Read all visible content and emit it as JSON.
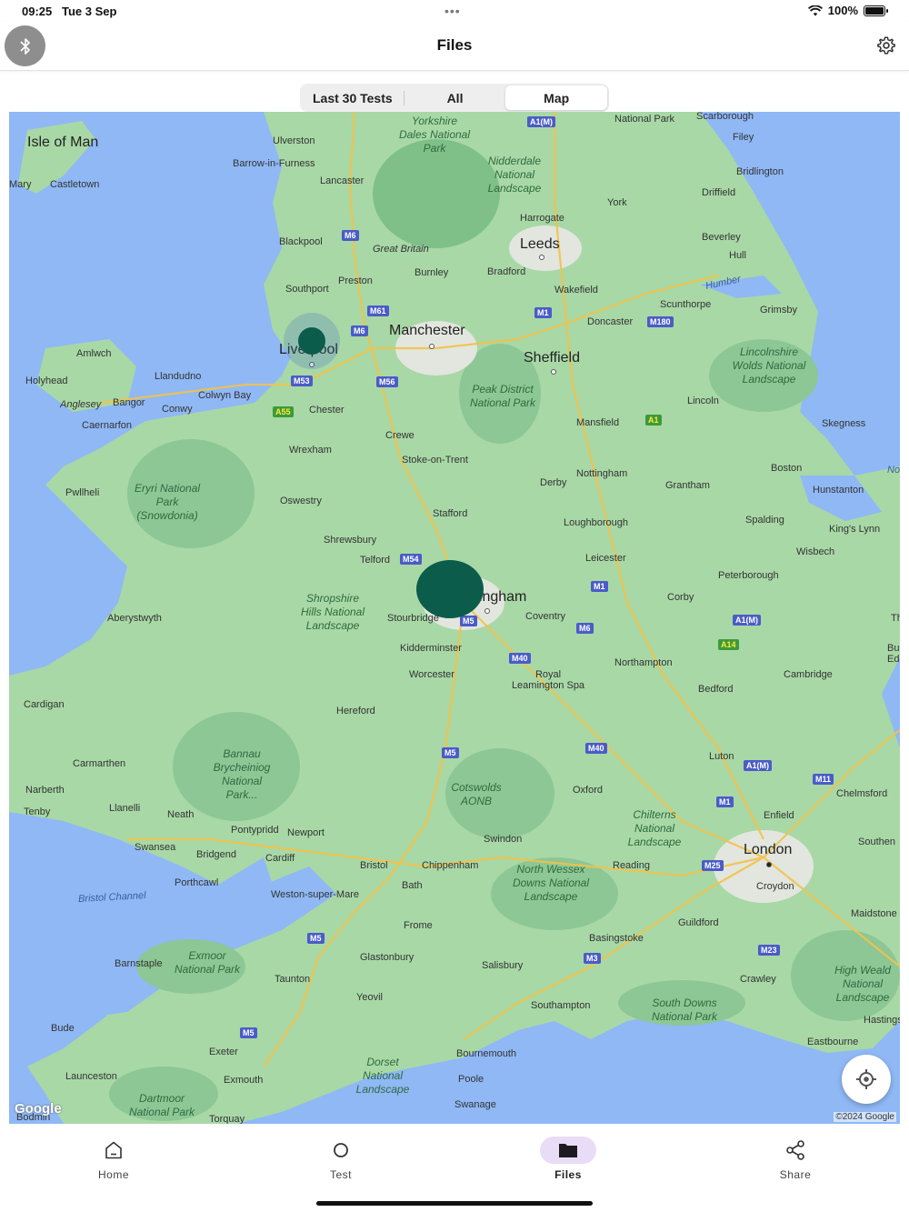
{
  "status_bar": {
    "time": "09:25",
    "date": "Tue 3 Sep",
    "battery": "100%"
  },
  "nav": {
    "title": "Files",
    "bluetooth_icon": "bluetooth-icon",
    "settings_icon": "gear-icon"
  },
  "segments": [
    {
      "label": "Last 30 Tests",
      "active": false
    },
    {
      "label": "All",
      "active": false
    },
    {
      "label": "Map",
      "active": true
    }
  ],
  "map": {
    "labels": {
      "isle_of_man": "Isle of Man",
      "ulverston": "Ulverston",
      "barrow": "Barrow-in-Furness",
      "castletown": "Castletown",
      "mary": "Mary",
      "yorkshire_dales": "Yorkshire Dales National Park",
      "nidderdale": "Nidderdale National Landscape",
      "national_park_ne": "National Park",
      "scarborough": "Scarborough",
      "filey": "Filey",
      "bridlington": "Bridlington",
      "driffield": "Driffield",
      "lancaster": "Lancaster",
      "york": "York",
      "harrogate": "Harrogate",
      "leeds": "Leeds",
      "beverley": "Beverley",
      "hull": "Hull",
      "blackpool": "Blackpool",
      "great_britain": "Great Britain",
      "burnley": "Burnley",
      "bradford": "Bradford",
      "preston": "Preston",
      "southport": "Southport",
      "wakefield": "Wakefield",
      "humber": "Humber",
      "scunthorpe": "Scunthorpe",
      "grimsby": "Grimsby",
      "manchester": "Manchester",
      "doncaster": "Doncaster",
      "amlwch": "Amlwch",
      "liverpool": "Liverpool",
      "sheffield": "Sheffield",
      "lincolnshire_wolds": "Lincolnshire Wolds National Landscape",
      "holyhead": "Holyhead",
      "llandudno": "Llandudno",
      "anglesey": "Anglesey",
      "bangor": "Bangor",
      "colwyn_bay": "Colwyn Bay",
      "conwy": "Conwy",
      "peak_district": "Peak District National Park",
      "lincoln": "Lincoln",
      "caernarfon": "Caernarfon",
      "chester": "Chester",
      "mansfield": "Mansfield",
      "skegness": "Skegness",
      "crewe": "Crewe",
      "wrexham": "Wrexham",
      "stoke": "Stoke-on-Trent",
      "boston": "Boston",
      "nottingham": "Nottingham",
      "derby": "Derby",
      "grantham": "Grantham",
      "pwllheli": "Pwllheli",
      "eryri": "Eryri National Park (Snowdonia)",
      "hunstanton": "Hunstanton",
      "oswestry": "Oswestry",
      "stafford": "Stafford",
      "loughborough": "Loughborough",
      "spalding": "Spalding",
      "kings_lynn": "King's Lynn",
      "shrewsbury": "Shrewsbury",
      "wisbech": "Wisbech",
      "telford": "Telford",
      "leicester": "Leicester",
      "peterborough": "Peterborough",
      "shropshire_hills": "Shropshire Hills National Landscape",
      "birmingham": "Birmingham",
      "corby": "Corby",
      "aberystwyth": "Aberystwyth",
      "stourbridge": "Stourbridge",
      "coventry": "Coventry",
      "kidderminster": "Kidderminster",
      "northampton": "Northampton",
      "royal_leamington": "Royal Leamington Spa",
      "worcester": "Worcester",
      "cambridge": "Cambridge",
      "cardigan": "Cardigan",
      "bedford": "Bedford",
      "hereford": "Hereford",
      "bannau": "Bannau Brycheiniog National Park...",
      "carmarthen": "Carmarthen",
      "luton": "Luton",
      "narberth": "Narberth",
      "cotswolds": "Cotswolds AONB",
      "oxford": "Oxford",
      "chelmsford": "Chelmsford",
      "tenby": "Tenby",
      "llanelli": "Llanelli",
      "neath": "Neath",
      "chilterns": "Chilterns National Landscape",
      "enfield": "Enfield",
      "pontypridd": "Pontypridd",
      "newport": "Newport",
      "swansea": "Swansea",
      "swindon": "Swindon",
      "london": "London",
      "bridgend": "Bridgend",
      "cardiff": "Cardiff",
      "bristol": "Bristol",
      "chippenham": "Chippenham",
      "reading": "Reading",
      "north_wessex": "North Wessex Downs National Landscape",
      "croydon": "Croydon",
      "porthcawl": "Porthcawl",
      "bath": "Bath",
      "bristol_channel": "Bristol Channel",
      "weston": "Weston-super-Mare",
      "maidstone": "Maidstone",
      "frome": "Frome",
      "guildford": "Guildford",
      "basingstoke": "Basingstoke",
      "exmoor": "Exmoor National Park",
      "glastonbury": "Glastonbury",
      "barnstaple": "Barnstaple",
      "salisbury": "Salisbury",
      "crawley": "Crawley",
      "high_weald": "High Weald National Landscape",
      "taunton": "Taunton",
      "yeovil": "Yeovil",
      "southampton": "Southampton",
      "south_downs": "South Downs National Park",
      "bude": "Bude",
      "hastings": "Hastings",
      "exeter": "Exeter",
      "bournemouth": "Bournemouth",
      "eastbourne": "Eastbourne",
      "dorset": "Dorset National Landscape",
      "launceston": "Launceston",
      "exmouth": "Exmouth",
      "poole": "Poole",
      "dartmoor": "Dartmoor National Park",
      "swanage": "Swanage",
      "bodmin": "Bodmin",
      "torquay": "Torquay",
      "southend": "Southen",
      "no": "No",
      "th": "Th",
      "bu_edn": "Bu Edn"
    },
    "roads": {
      "a1m_n": "A1(M)",
      "m6_n": "M6",
      "m61": "M61",
      "m6_mid": "M6",
      "m1_n": "M1",
      "m180": "M180",
      "m53": "M53",
      "m56": "M56",
      "a55": "A55",
      "a1": "A1",
      "m54": "M54",
      "m1_mid": "M1",
      "m6_s": "M6",
      "m5_n": "M5",
      "a1m_mid": "A1(M)",
      "a14": "A14",
      "m40_n": "M40",
      "m5_mid": "M5",
      "m40_s": "M40",
      "a1m_s": "A1(M)",
      "m11": "M11",
      "m1_s": "M1",
      "m25": "M25",
      "m5_s": "M5",
      "m3": "M3",
      "m23": "M23",
      "m5_sw": "M5"
    },
    "google": "Google",
    "copyright": "©2024 Google",
    "locate_icon": "locate-icon"
  },
  "tabs": [
    {
      "label": "Home",
      "icon": "home-icon",
      "active": false
    },
    {
      "label": "Test",
      "icon": "circle-icon",
      "active": false
    },
    {
      "label": "Files",
      "icon": "folder-icon",
      "active": true
    },
    {
      "label": "Share",
      "icon": "share-icon",
      "active": false
    }
  ]
}
